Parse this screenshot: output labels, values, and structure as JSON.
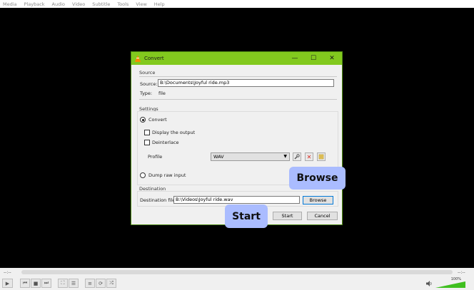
{
  "menu": [
    "Media",
    "Playback",
    "Audio",
    "Video",
    "Subtitle",
    "Tools",
    "View",
    "Help"
  ],
  "dialog": {
    "title": "Convert",
    "source_section": "Source",
    "source_label": "Source:",
    "source_value": "B:\\Documents\\Joyful ride.mp3",
    "type_label": "Type:",
    "type_value": "file",
    "settings_section": "Settings",
    "convert_label": "Convert",
    "display_output_label": "Display the output",
    "deinterlace_label": "Deinterlace",
    "profile_label": "Profile",
    "profile_value": "WAV",
    "dump_raw_label": "Dump raw input",
    "destination_section": "Destination",
    "destination_label": "Destination file:",
    "destination_value": "B:\\Videos\\Joyful ride.wav",
    "browse_label": "Browse",
    "start_label": "Start",
    "cancel_label": "Cancel"
  },
  "callouts": {
    "browse": "Browse",
    "start": "Start"
  },
  "player": {
    "time_left": "--:--",
    "time_right": "--:--",
    "volume": "100%",
    "volume_level": 1.0
  },
  "colors": {
    "titlebar": "#82c91e",
    "callout": "#aabcff",
    "volume": "#3fbf1f"
  }
}
